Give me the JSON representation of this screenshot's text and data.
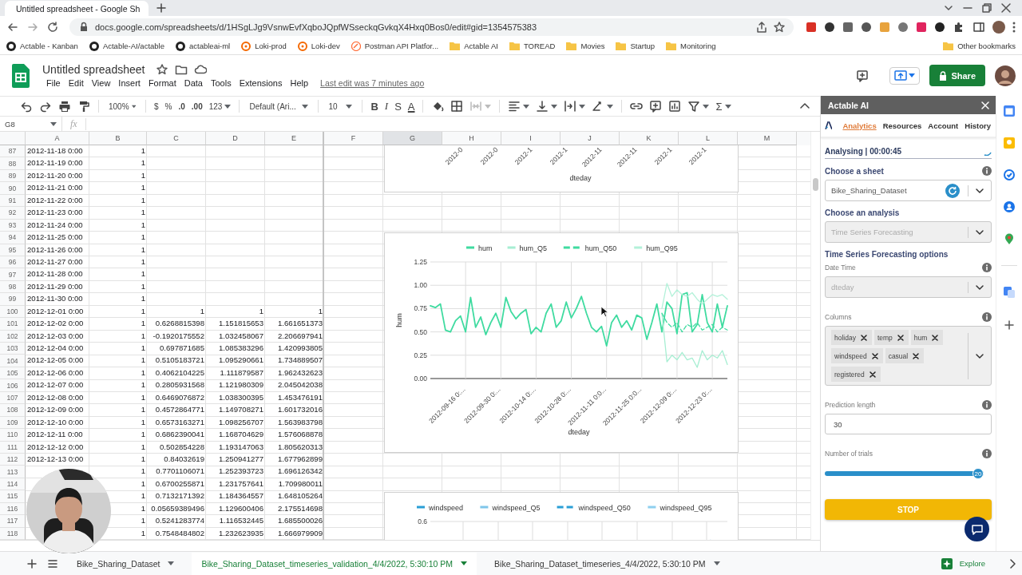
{
  "browser": {
    "tab_title": "Untitled spreadsheet - Google Sh",
    "url": "docs.google.com/spreadsheets/d/1HSgLJg9VsnwEvfXqboJQpfWSseckqGvkqX4Hxq0Bos0/edit#gid=1354575383",
    "bookmarks": [
      {
        "label": "Actable - Kanban",
        "kind": "github"
      },
      {
        "label": "Actable-AI/actable",
        "kind": "github"
      },
      {
        "label": "actableai-ml",
        "kind": "github"
      },
      {
        "label": "Loki-prod",
        "kind": "loki"
      },
      {
        "label": "Loki-dev",
        "kind": "loki"
      },
      {
        "label": "Postman API Platfor...",
        "kind": "postman"
      },
      {
        "label": "Actable AI",
        "kind": "folder"
      },
      {
        "label": "TOREAD",
        "kind": "folder"
      },
      {
        "label": "Movies",
        "kind": "folder"
      },
      {
        "label": "Startup",
        "kind": "folder"
      },
      {
        "label": "Monitoring",
        "kind": "folder"
      }
    ],
    "other_bookmarks": "Other bookmarks"
  },
  "sheets": {
    "title": "Untitled spreadsheet",
    "menus": [
      "File",
      "Edit",
      "View",
      "Insert",
      "Format",
      "Data",
      "Tools",
      "Extensions",
      "Help"
    ],
    "last_edit": "Last edit was 7 minutes ago",
    "share": "Share"
  },
  "toolbar": {
    "zoom": "100%",
    "currency": "$",
    "percent": "%",
    "decrease_decimals": ".0",
    "increase_decimals": ".00",
    "number_format": "123",
    "font": "Default (Ari...",
    "font_size": "10",
    "bold": "B",
    "italic": "I",
    "strikethrough": "S",
    "text_color": "A",
    "functions": "Σ"
  },
  "formula_bar": {
    "cell_ref": "G8",
    "fx": "fx"
  },
  "grid": {
    "columns": [
      {
        "label": "A",
        "selected": false
      },
      {
        "label": "B",
        "selected": false
      },
      {
        "label": "C",
        "selected": false
      },
      {
        "label": "D",
        "selected": false
      },
      {
        "label": "E",
        "selected": false
      },
      {
        "label": "F",
        "selected": false
      },
      {
        "label": "G",
        "selected": true
      },
      {
        "label": "H",
        "selected": false
      },
      {
        "label": "I",
        "selected": false
      },
      {
        "label": "J",
        "selected": false
      },
      {
        "label": "K",
        "selected": false
      },
      {
        "label": "L",
        "selected": false
      },
      {
        "label": "M",
        "selected": false
      }
    ],
    "rows": [
      {
        "number": "87",
        "date": "2012-11-18 0:00",
        "values": [
          "1"
        ]
      },
      {
        "number": "88",
        "date": "2012-11-19 0:00",
        "values": [
          "1"
        ]
      },
      {
        "number": "89",
        "date": "2012-11-20 0:00",
        "values": [
          "1"
        ]
      },
      {
        "number": "90",
        "date": "2012-11-21 0:00",
        "values": [
          "1"
        ]
      },
      {
        "number": "91",
        "date": "2012-11-22 0:00",
        "values": [
          "1"
        ]
      },
      {
        "number": "92",
        "date": "2012-11-23 0:00",
        "values": [
          "1"
        ]
      },
      {
        "number": "93",
        "date": "2012-11-24 0:00",
        "values": [
          "1"
        ]
      },
      {
        "number": "94",
        "date": "2012-11-25 0:00",
        "values": [
          "1"
        ]
      },
      {
        "number": "95",
        "date": "2012-11-26 0:00",
        "values": [
          "1"
        ]
      },
      {
        "number": "96",
        "date": "2012-11-27 0:00",
        "values": [
          "1"
        ]
      },
      {
        "number": "97",
        "date": "2012-11-28 0:00",
        "values": [
          "1"
        ]
      },
      {
        "number": "98",
        "date": "2012-11-29 0:00",
        "values": [
          "1"
        ]
      },
      {
        "number": "99",
        "date": "2012-11-30 0:00",
        "values": [
          "1"
        ]
      },
      {
        "number": "100",
        "date": "2012-12-01 0:00",
        "values": [
          "1",
          "1",
          "1",
          "1"
        ]
      },
      {
        "number": "101",
        "date": "2012-12-02 0:00",
        "values": [
          "1",
          "0.6268815398",
          "1.151815653",
          "1.661651373"
        ]
      },
      {
        "number": "102",
        "date": "2012-12-03 0:00",
        "values": [
          "1",
          "-0.1920175552",
          "1.032458067",
          "2.206697941"
        ]
      },
      {
        "number": "103",
        "date": "2012-12-04 0:00",
        "values": [
          "1",
          "0.697871685",
          "1.085383296",
          "1.420993805"
        ]
      },
      {
        "number": "104",
        "date": "2012-12-05 0:00",
        "values": [
          "1",
          "0.5105183721",
          "1.095290661",
          "1.734889507"
        ]
      },
      {
        "number": "105",
        "date": "2012-12-06 0:00",
        "values": [
          "1",
          "0.4062104225",
          "1.111879587",
          "1.962432623"
        ]
      },
      {
        "number": "106",
        "date": "2012-12-07 0:00",
        "values": [
          "1",
          "0.2805931568",
          "1.121980309",
          "2.045042038"
        ]
      },
      {
        "number": "107",
        "date": "2012-12-08 0:00",
        "values": [
          "1",
          "0.6469076872",
          "1.038300395",
          "1.453476191"
        ]
      },
      {
        "number": "108",
        "date": "2012-12-09 0:00",
        "values": [
          "1",
          "0.4572864771",
          "1.149708271",
          "1.601732016"
        ]
      },
      {
        "number": "109",
        "date": "2012-12-10 0:00",
        "values": [
          "1",
          "0.6573163271",
          "1.098256707",
          "1.563983798"
        ]
      },
      {
        "number": "110",
        "date": "2012-12-11 0:00",
        "values": [
          "1",
          "0.6862390041",
          "1.168704629",
          "1.576068878"
        ]
      },
      {
        "number": "111",
        "date": "2012-12-12 0:00",
        "values": [
          "1",
          "0.502854228",
          "1.193147063",
          "1.805620313"
        ]
      },
      {
        "number": "112",
        "date": "2012-12-13 0:00",
        "values": [
          "1",
          "0.84032619",
          "1.250941277",
          "1.677962899"
        ]
      },
      {
        "number": "113",
        "values": [
          "1",
          "0.7701106071",
          "1.252393723",
          "1.696126342"
        ]
      },
      {
        "number": "114",
        "values": [
          "1",
          "0.6700255871",
          "1.231757641",
          "1.709980011"
        ]
      },
      {
        "number": "115",
        "values": [
          "1",
          "0.7132171392",
          "1.184364557",
          "1.648105264"
        ]
      },
      {
        "number": "116",
        "values": [
          "1",
          "0.05659389496",
          "1.129600406",
          "2.175514698"
        ]
      },
      {
        "number": "117",
        "values": [
          "1",
          "0.5241283774",
          "1.116532445",
          "1.685500026"
        ]
      },
      {
        "number": "118",
        "values": [
          "1",
          "0.7548484802",
          "1.232623935",
          "1.666979909"
        ]
      }
    ]
  },
  "top_chart": {
    "xtick_labels": [
      "2012-0",
      "2012-0",
      "2012-1",
      "2012-1",
      "2012-11",
      "2012-11",
      "2012-1",
      "2012-1"
    ],
    "xlabel": "dteday"
  },
  "hum_chart": {
    "chart_data": {
      "type": "line",
      "xlabel": "dteday",
      "ylabel": "hum",
      "grid": true,
      "legend": true,
      "ylim": [
        0,
        1.25
      ],
      "categories": [
        null,
        null,
        null,
        null,
        null,
        null,
        null,
        "2012-09-16 0:...",
        null,
        null,
        null,
        null,
        null,
        null,
        "2012-09-30 0:...",
        null,
        null,
        null,
        null,
        null,
        null,
        "2012-10-14 0:...",
        null,
        null,
        null,
        null,
        null,
        null,
        "2012-10-28 0:...",
        null,
        null,
        null,
        null,
        null,
        null,
        "2012-11-11 0:0...",
        null,
        null,
        null,
        null,
        null,
        null,
        "2012-11-25 0:0...",
        null,
        null,
        null,
        null,
        null,
        null,
        "2012-12-09 0:...",
        null,
        null,
        null,
        null,
        null,
        null,
        "2012-12-23 0:...",
        null,
        null,
        null
      ],
      "yticks": [
        {
          "value": 0,
          "label": "0.00"
        },
        {
          "value": 0.25,
          "label": "0.25"
        },
        {
          "value": 0.5,
          "label": "0.50"
        },
        {
          "value": 0.75,
          "label": "0.75"
        },
        {
          "value": 1,
          "label": "1.00"
        },
        {
          "value": 1.25,
          "label": "1.25"
        }
      ],
      "series": [
        {
          "name": "hum",
          "color": "#3fdba0",
          "line_style": "solid",
          "values": [
            0.78,
            0.76,
            0.8,
            0.52,
            0.5,
            0.62,
            0.67,
            0.5,
            0.87,
            0.55,
            0.66,
            0.47,
            0.6,
            0.7,
            0.55,
            0.87,
            0.72,
            0.64,
            0.7,
            0.74,
            0.48,
            0.55,
            0.5,
            0.7,
            0.8,
            0.55,
            0.62,
            0.82,
            0.65,
            0.75,
            0.88,
            0.7,
            0.55,
            0.5,
            0.56,
            0.35,
            0.6,
            0.68,
            0.55,
            0.62,
            0.52,
            0.68,
            0.65,
            0.42,
            0.6,
            0.8,
            0.5,
            0.82,
            0.75,
            0.48,
            0.9,
            0.92,
            0.5,
            0.58,
            0.9,
            0.6,
            0.5,
            0.8,
            0.55,
            0.78
          ]
        },
        {
          "name": "hum_Q5",
          "color": "#a6eed2",
          "line_style": "solid",
          "values": [
            null,
            null,
            null,
            null,
            null,
            null,
            null,
            null,
            null,
            null,
            null,
            null,
            null,
            null,
            null,
            null,
            null,
            null,
            null,
            null,
            null,
            null,
            null,
            null,
            null,
            null,
            null,
            null,
            null,
            null,
            null,
            null,
            null,
            null,
            null,
            null,
            null,
            null,
            null,
            null,
            null,
            null,
            null,
            null,
            null,
            null,
            0.7,
            0.18,
            0.25,
            0.2,
            0.28,
            0.2,
            0.22,
            0.12,
            0.3,
            0.2,
            0.25,
            0.22,
            0.3,
            0.15
          ]
        },
        {
          "name": "hum_Q50",
          "color": "#3fdba0",
          "line_style": "dashed",
          "values": [
            null,
            null,
            null,
            null,
            null,
            null,
            null,
            null,
            null,
            null,
            null,
            null,
            null,
            null,
            null,
            null,
            null,
            null,
            null,
            null,
            null,
            null,
            null,
            null,
            null,
            null,
            null,
            null,
            null,
            null,
            null,
            null,
            null,
            null,
            null,
            null,
            null,
            null,
            null,
            null,
            null,
            null,
            null,
            null,
            null,
            null,
            0.7,
            0.6,
            0.55,
            0.6,
            0.5,
            0.58,
            0.55,
            0.6,
            0.52,
            0.55,
            0.58,
            0.5,
            0.55,
            0.52
          ]
        },
        {
          "name": "hum_Q95",
          "color": "#b3f1d9",
          "line_style": "solid",
          "values": [
            null,
            null,
            null,
            null,
            null,
            null,
            null,
            null,
            null,
            null,
            null,
            null,
            null,
            null,
            null,
            null,
            null,
            null,
            null,
            null,
            null,
            null,
            null,
            null,
            null,
            null,
            null,
            null,
            null,
            null,
            null,
            null,
            null,
            null,
            null,
            null,
            null,
            null,
            null,
            null,
            null,
            null,
            null,
            null,
            null,
            null,
            0.75,
            1.02,
            0.88,
            0.95,
            0.9,
            0.88,
            0.92,
            0.85,
            0.8,
            0.85,
            0.9,
            0.88,
            0.9,
            0.85
          ]
        }
      ]
    }
  },
  "wind_chart": {
    "series": [
      {
        "name": "windspeed",
        "color": "#2a9fd6",
        "kind": "solid"
      },
      {
        "name": "windspeed_Q5",
        "color": "#7fc6ea",
        "kind": "solid"
      },
      {
        "name": "windspeed_Q50",
        "color": "#2a9fd6",
        "kind": "dashed"
      },
      {
        "name": "windspeed_Q95",
        "color": "#8fd0ef",
        "kind": "solid"
      }
    ],
    "ytick": "0.6"
  },
  "addon": {
    "title": "Actable AI",
    "tabs": [
      {
        "label": "Analytics",
        "selected": true
      },
      {
        "label": "Resources",
        "selected": false
      },
      {
        "label": "Account",
        "selected": false
      },
      {
        "label": "History",
        "selected": false
      }
    ],
    "status": "Analysing | 00:00:45",
    "items": [
      {
        "kind": "heading",
        "text": "Choose a sheet",
        "info": true
      },
      {
        "kind": "select",
        "value": "Bike_Sharing_Dataset",
        "disabled": false,
        "refresh": true
      },
      {
        "kind": "heading",
        "text": "Choose an analysis",
        "info": false
      },
      {
        "kind": "select",
        "value": "Time Series Forecasting",
        "disabled": true,
        "refresh": false
      },
      {
        "kind": "heading",
        "text": "Time Series Forecasting options",
        "info": false
      },
      {
        "kind": "label",
        "text": "Date Time",
        "info": true
      },
      {
        "kind": "select",
        "value": "dteday",
        "disabled": true,
        "refresh": false
      },
      {
        "kind": "label",
        "text": "Columns",
        "info": true
      },
      {
        "kind": "multiselect",
        "chips": [
          "holiday",
          "temp",
          "hum",
          "windspeed",
          "casual",
          "registered"
        ]
      },
      {
        "kind": "label",
        "text": "Prediction length",
        "info": true
      },
      {
        "kind": "input",
        "value": "30"
      },
      {
        "kind": "label",
        "text": "Number of trials",
        "info": true
      },
      {
        "kind": "slider",
        "level": 1.0,
        "value": "20"
      },
      {
        "kind": "button",
        "text": "STOP"
      }
    ]
  },
  "sheet_tabs": [
    {
      "label": "Bike_Sharing_Dataset",
      "selected": false
    },
    {
      "label": "Bike_Sharing_Dataset_timeseries_validation_4/4/2022, 5:30:10 PM",
      "selected": true
    },
    {
      "label": "Bike_Sharing_Dataset_timeseries_4/4/2022, 5:30:10 PM",
      "selected": false
    }
  ],
  "explore": "Explore"
}
